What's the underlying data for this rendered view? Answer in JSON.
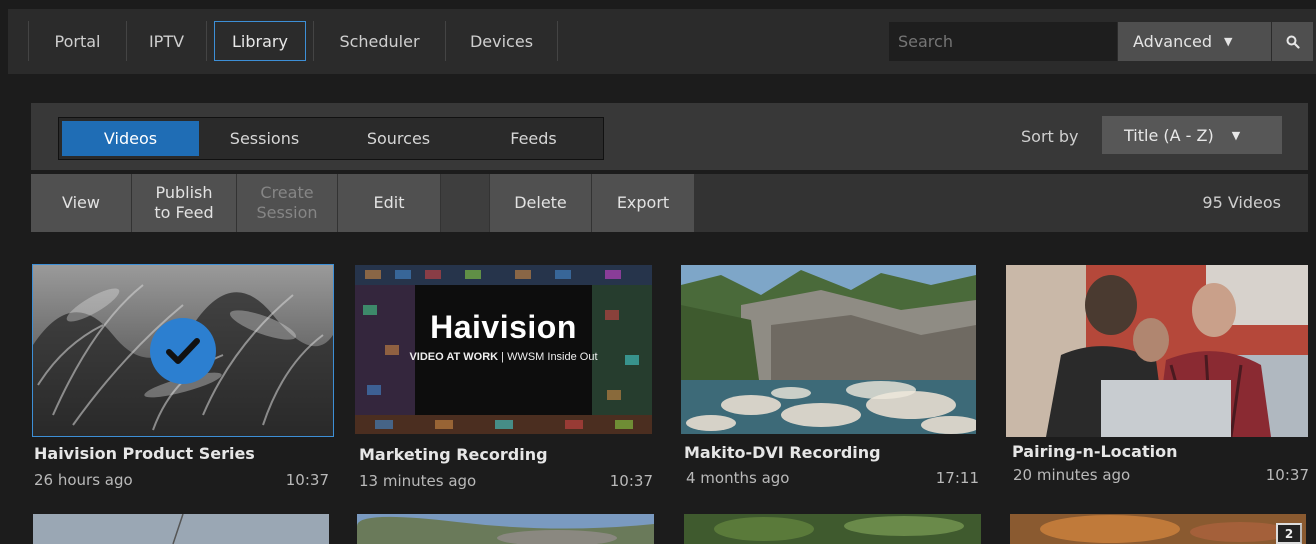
{
  "nav": {
    "items": [
      "Portal",
      "IPTV",
      "Library",
      "Scheduler",
      "Devices"
    ],
    "active": "Library"
  },
  "search": {
    "placeholder": "Search",
    "advanced_label": "Advanced",
    "search_icon": "search-icon"
  },
  "library": {
    "tabs": [
      "Videos",
      "Sessions",
      "Sources",
      "Feeds"
    ],
    "active_tab": "Videos",
    "sort_label": "Sort by",
    "sort_value": "Title (A - Z)"
  },
  "toolbar": {
    "view": "View",
    "publish_line1": "Publish",
    "publish_line2": "to Feed",
    "create_line1": "Create",
    "create_line2": "Session",
    "edit": "Edit",
    "delete": "Delete",
    "export": "Export",
    "count": "95 Videos"
  },
  "videos": [
    {
      "title": "Haivision Product Series",
      "age": "26 hours ago",
      "duration": "10:37",
      "selected": true
    },
    {
      "title": "Marketing Recording",
      "age": "13 minutes ago",
      "duration": "10:37",
      "selected": false,
      "thumb_brand": "Haivision",
      "thumb_tagline": "VIDEO AT WORK",
      "thumb_subtitle": "WWSM Inside Out"
    },
    {
      "title": "Makito-DVI Recording",
      "age": "4 months ago",
      "duration": "17:11",
      "selected": false
    },
    {
      "title": "Pairing-n-Location",
      "age": "20 minutes ago",
      "duration": "10:37",
      "selected": false
    }
  ],
  "second_row_badge": "2",
  "colors": {
    "accent": "#1f6db5",
    "selection_border": "#3d8fd6",
    "background": "#1c1c1c"
  }
}
